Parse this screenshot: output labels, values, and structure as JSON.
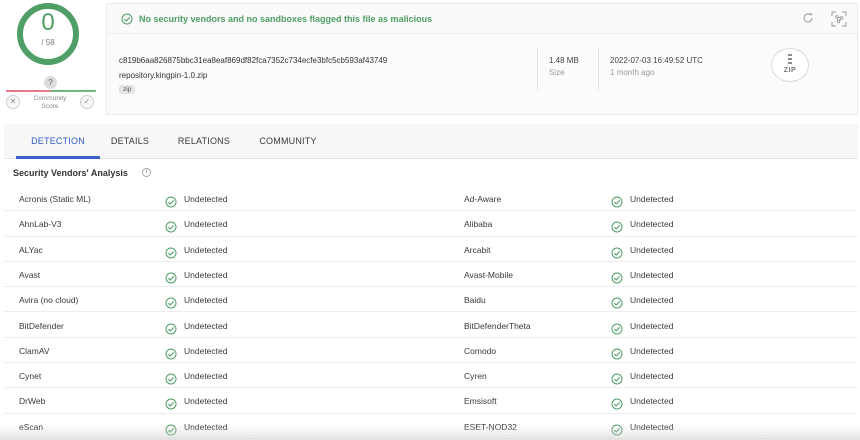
{
  "score": {
    "detections": "0",
    "total": "/ 58",
    "ring_color": "#4f9e66"
  },
  "community": {
    "help_glyph": "?",
    "label": "Community Score",
    "down_glyph": "✕",
    "up_glyph": "✓"
  },
  "banner": {
    "message": "No security vendors and no sandboxes flagged this file as malicious",
    "icons": [
      "refresh-icon",
      "similar-graph-icon"
    ]
  },
  "file": {
    "hash": "c819b6aa826875bbc31ea8eaf869df82fca7352c734ecfe3bfc5cb593af43749",
    "name": "repository.kingpin-1.0.zip",
    "tag": "zip",
    "size_value": "1.48 MB",
    "size_label": "Size",
    "date_value": "2022-07-03 16:49:52 UTC",
    "date_relative": "1 month ago",
    "type_label": "ZIP"
  },
  "tabs": [
    {
      "label": "DETECTION",
      "active": true
    },
    {
      "label": "DETAILS",
      "active": false
    },
    {
      "label": "RELATIONS",
      "active": false
    },
    {
      "label": "COMMUNITY",
      "active": false
    }
  ],
  "section": {
    "title": "Security Vendors' Analysis",
    "info_glyph": "i"
  },
  "result_color": "#4f9e66",
  "vendors": [
    {
      "left": "Acronis (Static ML)",
      "left_result": "Undetected",
      "right": "Ad-Aware",
      "right_result": "Undetected"
    },
    {
      "left": "AhnLab-V3",
      "left_result": "Undetected",
      "right": "Alibaba",
      "right_result": "Undetected"
    },
    {
      "left": "ALYac",
      "left_result": "Undetected",
      "right": "Arcabit",
      "right_result": "Undetected"
    },
    {
      "left": "Avast",
      "left_result": "Undetected",
      "right": "Avast-Mobile",
      "right_result": "Undetected"
    },
    {
      "left": "Avira (no cloud)",
      "left_result": "Undetected",
      "right": "Baidu",
      "right_result": "Undetected"
    },
    {
      "left": "BitDefender",
      "left_result": "Undetected",
      "right": "BitDefenderTheta",
      "right_result": "Undetected"
    },
    {
      "left": "ClamAV",
      "left_result": "Undetected",
      "right": "Comodo",
      "right_result": "Undetected"
    },
    {
      "left": "Cynet",
      "left_result": "Undetected",
      "right": "Cyren",
      "right_result": "Undetected"
    },
    {
      "left": "DrWeb",
      "left_result": "Undetected",
      "right": "Emsisoft",
      "right_result": "Undetected"
    },
    {
      "left": "eScan",
      "left_result": "Undetected",
      "right": "ESET-NOD32",
      "right_result": "Undetected"
    }
  ]
}
